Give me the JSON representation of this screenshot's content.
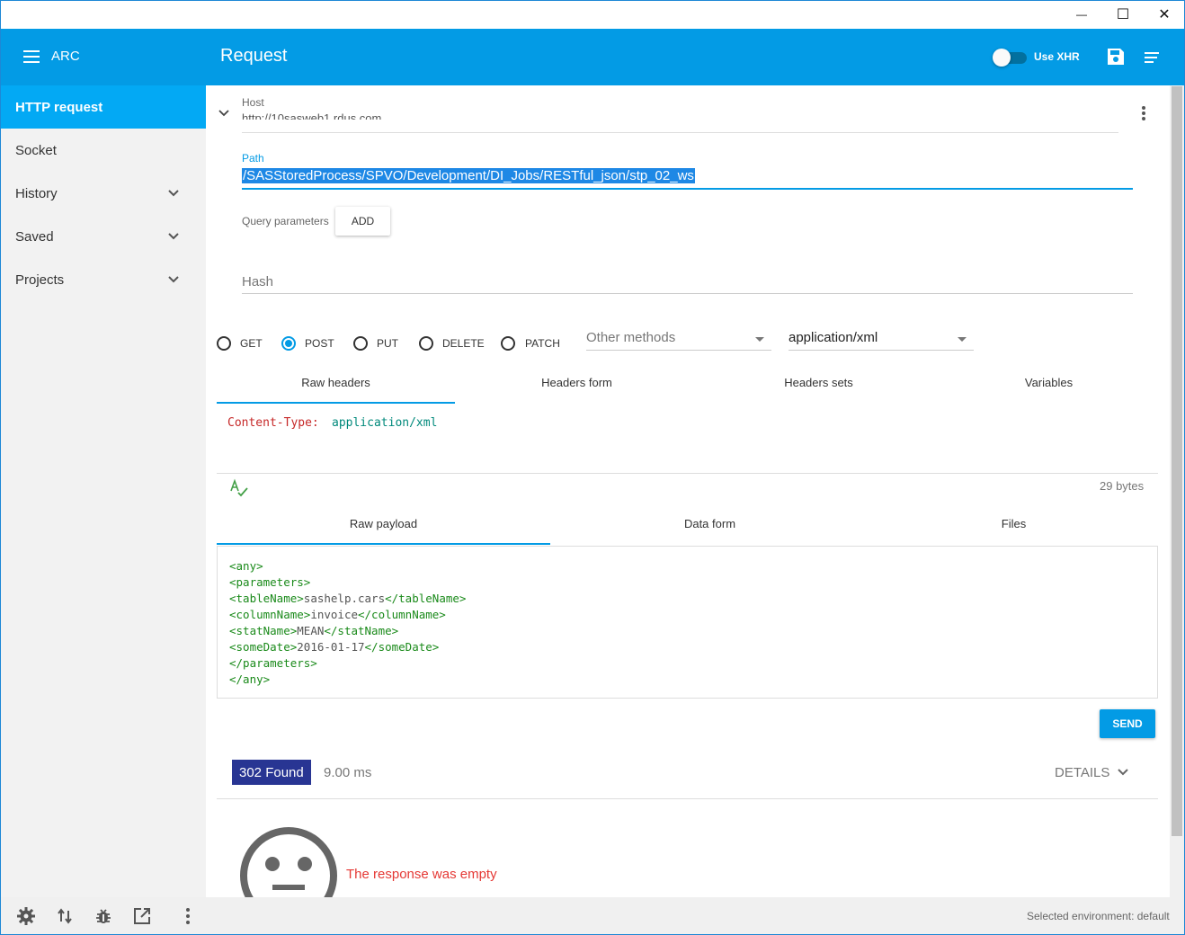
{
  "window": {
    "minimize_glyph": "—",
    "maximize_glyph": "☐",
    "close_glyph": "✕"
  },
  "appbar": {
    "app_name": "ARC",
    "title": "Request",
    "xhr_label": "Use XHR",
    "colors": {
      "primary": "#039be5",
      "active_nav": "#03a9f4"
    }
  },
  "sidebar": {
    "items": [
      {
        "label": "HTTP request"
      },
      {
        "label": "Socket"
      },
      {
        "label": "History"
      },
      {
        "label": "Saved"
      },
      {
        "label": "Projects"
      }
    ]
  },
  "request": {
    "host_label": "Host",
    "host_value": "http://10sasweb1.rdus.com",
    "path_label": "Path",
    "path_value": "/SASStoredProcess/SPVO/Development/DI_Jobs/RESTful_json/stp_02_ws",
    "query_label": "Query parameters",
    "add_label": "ADD",
    "hash_placeholder": "Hash",
    "methods": [
      "GET",
      "POST",
      "PUT",
      "DELETE",
      "PATCH"
    ],
    "selected_method": "POST",
    "other_methods_placeholder": "Other methods",
    "content_type": "application/xml"
  },
  "header_tabs": [
    "Raw headers",
    "Headers form",
    "Headers sets",
    "Variables"
  ],
  "headers": {
    "key": "Content-Type:",
    "value": "application/xml"
  },
  "payload_size": "29 bytes",
  "body_tabs": [
    "Raw payload",
    "Data form",
    "Files"
  ],
  "payload_lines": [
    {
      "open": "<any>",
      "text": "",
      "close": ""
    },
    {
      "open": "<parameters>",
      "text": "",
      "close": ""
    },
    {
      "open": "<tableName>",
      "text": "sashelp.cars",
      "close": "</tableName>"
    },
    {
      "open": "<columnName>",
      "text": "invoice",
      "close": "</columnName>"
    },
    {
      "open": "<statName>",
      "text": "MEAN",
      "close": "</statName>"
    },
    {
      "open": "<someDate>",
      "text": "2016-01-17",
      "close": "</someDate>"
    },
    {
      "open": "</parameters>",
      "text": "",
      "close": ""
    },
    {
      "open": "</any>",
      "text": "",
      "close": ""
    }
  ],
  "send_label": "SEND",
  "response": {
    "status": "302 Found",
    "time": "9.00 ms",
    "details_label": "DETAILS",
    "empty_message": "The response was empty",
    "status_color": "#283593",
    "empty_color": "#e53935"
  },
  "footer": {
    "environment": "Selected environment: default"
  }
}
